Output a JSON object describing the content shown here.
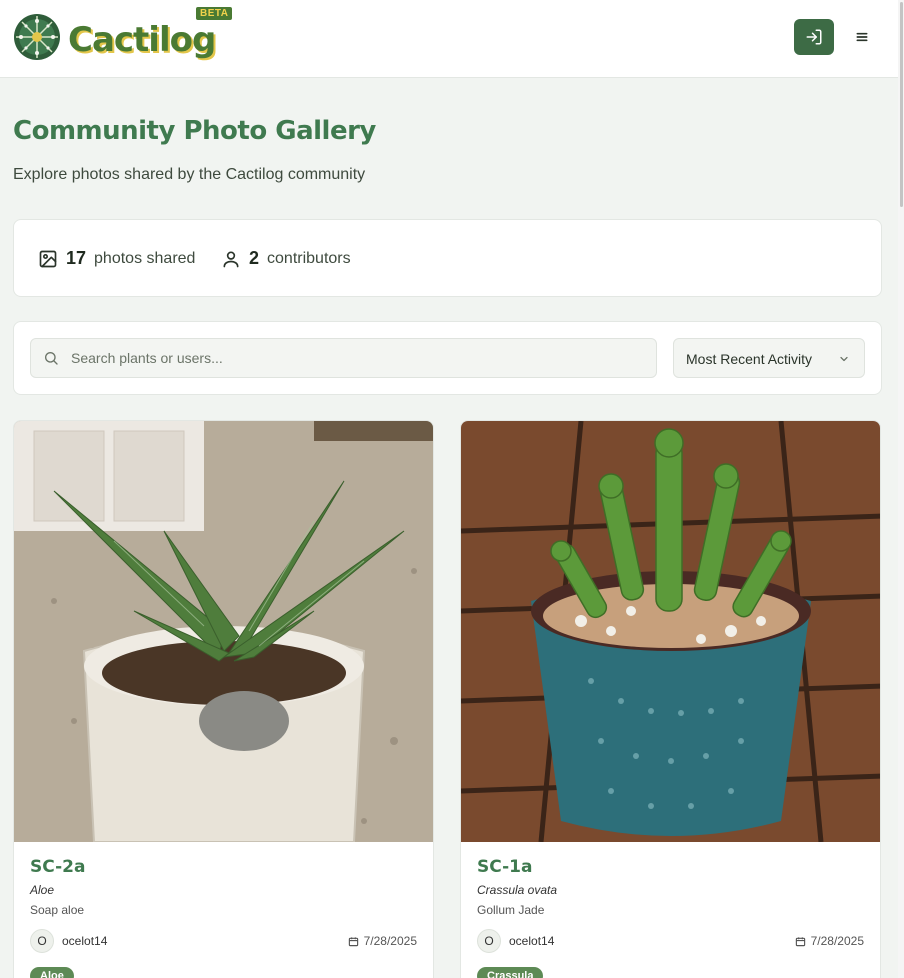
{
  "header": {
    "brand": "Cactilog",
    "beta_badge": "BETA",
    "login_icon": "login-icon",
    "menu_icon": "menu-icon"
  },
  "page": {
    "title": "Community Photo Gallery",
    "subtitle": "Explore photos shared by the Cactilog community"
  },
  "stats": {
    "photos_count": "17",
    "photos_label": "photos shared",
    "contributors_count": "2",
    "contributors_label": "contributors"
  },
  "filters": {
    "search_placeholder": "Search plants or users...",
    "search_value": "",
    "sort_selected": "Most Recent Activity"
  },
  "cards": [
    {
      "name": "SC-2a",
      "scientific": "Aloe",
      "common": "Soap aloe",
      "avatar_initial": "O",
      "user": "ocelot14",
      "date": "7/28/2025",
      "tag": "Aloe"
    },
    {
      "name": "SC-1a",
      "scientific": "Crassula ovata",
      "common": "Gollum Jade",
      "avatar_initial": "O",
      "user": "ocelot14",
      "date": "7/28/2025",
      "tag": "Crassula"
    }
  ],
  "colors": {
    "brand_green": "#3f7a4f",
    "button_green": "#3d6b45",
    "brand_yellow": "#e3c64a",
    "background": "#f1f4f1"
  }
}
